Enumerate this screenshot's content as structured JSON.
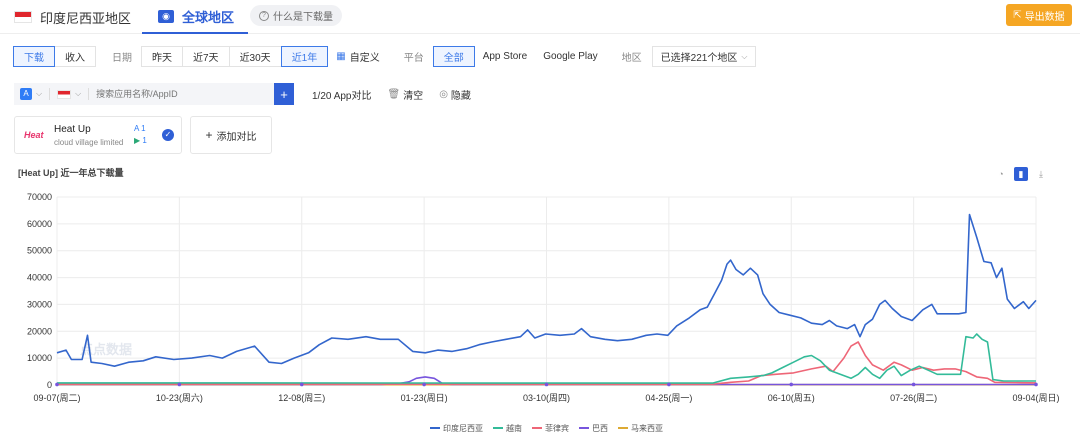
{
  "topbar": {
    "country_tab": "印度尼西亚地区",
    "global_tab": "全球地区",
    "help": "什么是下载量",
    "export": "导出数据"
  },
  "filters": {
    "metric": [
      "下载",
      "收入"
    ],
    "metric_active": 0,
    "date_label": "日期",
    "dates": [
      "昨天",
      "近7天",
      "近30天",
      "近1年"
    ],
    "date_active": 3,
    "custom": "自定义",
    "platform_label": "平台",
    "platforms": [
      "全部",
      "App Store",
      "Google Play"
    ],
    "platform_active": 0,
    "region_label": "地区",
    "region_value": "已选择221个地区"
  },
  "search": {
    "placeholder": "搜索应用名称/AppID",
    "count": "1/20 App对比",
    "clear": "清空",
    "hide": "隐藏"
  },
  "app": {
    "icon_text": "Heat",
    "name": "Heat Up",
    "developer": "cloud village limited",
    "ios_count": "1",
    "android_count": "1",
    "add_compare": "添加对比"
  },
  "chart_title": "[Heat Up]  近一年总下载量",
  "watermark": "点点数据",
  "chart_data": {
    "type": "line",
    "x_labels": [
      "09-07(周二)",
      "10-23(周六)",
      "12-08(周三)",
      "01-23(周日)",
      "03-10(周四)",
      "04-25(周一)",
      "06-10(周五)",
      "07-26(周二)",
      "09-04(周日)"
    ],
    "y_ticks": [
      0,
      10000,
      20000,
      30000,
      40000,
      50000,
      60000,
      70000
    ],
    "ylim": [
      0,
      70000
    ],
    "legend_position": "bottom",
    "series": [
      {
        "name": "印度尼西亚",
        "color": "#3366cc",
        "points": [
          [
            0,
            12000
          ],
          [
            5,
            13000
          ],
          [
            8,
            9500
          ],
          [
            14,
            9500
          ],
          [
            17,
            18500
          ],
          [
            19,
            8500
          ],
          [
            25,
            8000
          ],
          [
            32,
            7000
          ],
          [
            40,
            8500
          ],
          [
            48,
            9000
          ],
          [
            55,
            10500
          ],
          [
            65,
            9500
          ],
          [
            75,
            10000
          ],
          [
            85,
            11000
          ],
          [
            92,
            10000
          ],
          [
            100,
            12500
          ],
          [
            110,
            14500
          ],
          [
            118,
            8500
          ],
          [
            125,
            8000
          ],
          [
            132,
            10000
          ],
          [
            140,
            12000
          ],
          [
            146,
            15000
          ],
          [
            153,
            17500
          ],
          [
            162,
            17000
          ],
          [
            172,
            18000
          ],
          [
            180,
            17000
          ],
          [
            190,
            17000
          ],
          [
            198,
            12500
          ],
          [
            205,
            12000
          ],
          [
            212,
            13000
          ],
          [
            220,
            12500
          ],
          [
            228,
            13500
          ],
          [
            235,
            15000
          ],
          [
            242,
            16000
          ],
          [
            250,
            17000
          ],
          [
            258,
            18000
          ],
          [
            262,
            20500
          ],
          [
            266,
            17500
          ],
          [
            272,
            19000
          ],
          [
            280,
            18500
          ],
          [
            288,
            19000
          ],
          [
            292,
            21000
          ],
          [
            297,
            18000
          ],
          [
            305,
            17000
          ],
          [
            312,
            16500
          ],
          [
            320,
            17000
          ],
          [
            328,
            18500
          ],
          [
            334,
            19000
          ],
          [
            340,
            18500
          ],
          [
            345,
            22000
          ],
          [
            352,
            25000
          ],
          [
            358,
            28000
          ],
          [
            362,
            29000
          ],
          [
            366,
            34000
          ],
          [
            370,
            39000
          ],
          [
            373,
            45000
          ],
          [
            375,
            46500
          ],
          [
            378,
            43000
          ],
          [
            382,
            41000
          ],
          [
            386,
            43500
          ],
          [
            390,
            41000
          ],
          [
            393,
            34000
          ],
          [
            397,
            30000
          ],
          [
            402,
            27000
          ],
          [
            408,
            26000
          ],
          [
            414,
            25000
          ],
          [
            420,
            23000
          ],
          [
            426,
            22500
          ],
          [
            430,
            24000
          ],
          [
            434,
            22000
          ],
          [
            440,
            21000
          ],
          [
            444,
            22500
          ],
          [
            447,
            18000
          ],
          [
            450,
            22500
          ],
          [
            454,
            24500
          ],
          [
            458,
            30000
          ],
          [
            461,
            31500
          ],
          [
            465,
            28500
          ],
          [
            470,
            25500
          ],
          [
            476,
            24000
          ],
          [
            482,
            28000
          ],
          [
            487,
            30000
          ],
          [
            490,
            26500
          ],
          [
            496,
            26500
          ],
          [
            502,
            26500
          ],
          [
            506,
            27000
          ],
          [
            508,
            63500
          ],
          [
            512,
            55000
          ],
          [
            516,
            46000
          ],
          [
            520,
            45500
          ],
          [
            523,
            40000
          ],
          [
            526,
            43500
          ],
          [
            529,
            32000
          ],
          [
            533,
            28500
          ],
          [
            538,
            31000
          ],
          [
            541,
            28500
          ],
          [
            545,
            31500
          ]
        ]
      },
      {
        "name": "越南",
        "color": "#33bb99",
        "points": [
          [
            0,
            800
          ],
          [
            350,
            700
          ],
          [
            365,
            700
          ],
          [
            375,
            2500
          ],
          [
            385,
            3000
          ],
          [
            393,
            3500
          ],
          [
            398,
            4500
          ],
          [
            404,
            6500
          ],
          [
            410,
            8500
          ],
          [
            416,
            10500
          ],
          [
            420,
            11000
          ],
          [
            425,
            9000
          ],
          [
            430,
            5500
          ],
          [
            436,
            4000
          ],
          [
            442,
            2500
          ],
          [
            446,
            4000
          ],
          [
            450,
            6500
          ],
          [
            454,
            4000
          ],
          [
            458,
            2500
          ],
          [
            462,
            5500
          ],
          [
            466,
            7000
          ],
          [
            470,
            3500
          ],
          [
            475,
            5500
          ],
          [
            480,
            7000
          ],
          [
            485,
            5500
          ],
          [
            490,
            4000
          ],
          [
            496,
            4000
          ],
          [
            503,
            4000
          ],
          [
            506,
            18000
          ],
          [
            510,
            17500
          ],
          [
            512,
            19000
          ],
          [
            515,
            17000
          ],
          [
            518,
            16000
          ],
          [
            521,
            2000
          ],
          [
            527,
            1500
          ],
          [
            545,
            1500
          ]
        ]
      },
      {
        "name": "菲律宾",
        "color": "#ee6677",
        "points": [
          [
            0,
            300
          ],
          [
            365,
            300
          ],
          [
            375,
            1000
          ],
          [
            385,
            1500
          ],
          [
            392,
            3500
          ],
          [
            400,
            4000
          ],
          [
            410,
            4500
          ],
          [
            420,
            6000
          ],
          [
            428,
            7000
          ],
          [
            432,
            5000
          ],
          [
            438,
            10000
          ],
          [
            442,
            14500
          ],
          [
            446,
            16000
          ],
          [
            450,
            11000
          ],
          [
            454,
            7500
          ],
          [
            460,
            5500
          ],
          [
            466,
            8500
          ],
          [
            470,
            7500
          ],
          [
            476,
            5500
          ],
          [
            482,
            6500
          ],
          [
            488,
            5500
          ],
          [
            494,
            6000
          ],
          [
            500,
            6000
          ],
          [
            506,
            5000
          ],
          [
            512,
            3000
          ],
          [
            518,
            2500
          ],
          [
            522,
            1000
          ],
          [
            545,
            800
          ]
        ]
      },
      {
        "name": "巴西",
        "color": "#7755dd",
        "points": [
          [
            0,
            200
          ],
          [
            180,
            200
          ],
          [
            190,
            500
          ],
          [
            196,
            1200
          ],
          [
            200,
            2500
          ],
          [
            205,
            3000
          ],
          [
            210,
            2500
          ],
          [
            215,
            400
          ],
          [
            220,
            200
          ],
          [
            545,
            200
          ]
        ]
      },
      {
        "name": "马来西亚",
        "color": "#ddaa33",
        "points": [
          [
            0,
            100
          ],
          [
            545,
            100
          ]
        ]
      }
    ]
  }
}
